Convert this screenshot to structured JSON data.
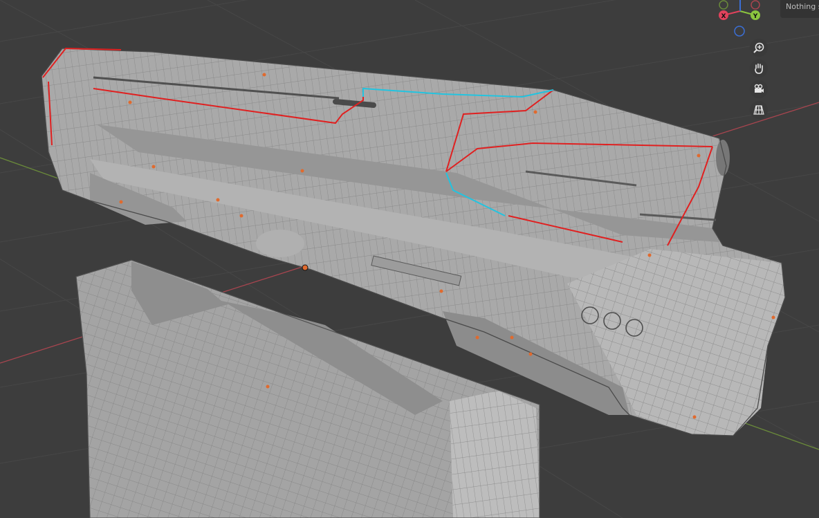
{
  "viewport": {
    "status_text": "Nothing selected",
    "gizmo": {
      "x_label": "X",
      "y_label": "Y",
      "x_color": "#e2425c",
      "y_color": "#8bc53f",
      "z_color": "#3b6fd6"
    },
    "nav_tools": [
      {
        "name": "zoom",
        "icon": "zoom-in-icon"
      },
      {
        "name": "pan",
        "icon": "hand-icon"
      },
      {
        "name": "camera",
        "icon": "camera-icon"
      },
      {
        "name": "perspective",
        "icon": "grid-icon"
      }
    ],
    "colors": {
      "background": "#3d3d3d",
      "grid": "#474747",
      "axis_x": "#a8454f",
      "axis_y": "#6a8a3a",
      "edge_selected": "#e02020",
      "edge_active": "#22c4e0",
      "mesh": "#a9a9a9"
    }
  }
}
